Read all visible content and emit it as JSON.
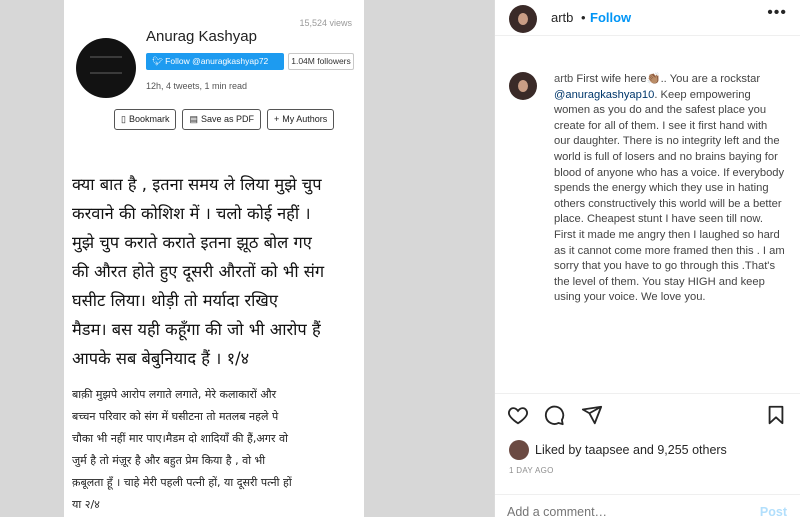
{
  "photo": {
    "views": "15,524 views",
    "author": "Anurag Kashyap",
    "follow_twitter": "Follow @anuragkashyap72",
    "followers": "1.04M followers",
    "meta": "12h, 4 tweets, 1 min read",
    "buttons": {
      "bookmark": "Bookmark",
      "save_pdf": "Save as PDF",
      "my_authors": "My Authors"
    },
    "hindi_big_lines": [
      "क्या बात है , इतना समय ले लिया मुझे चुप",
      "करवाने की कोशिश में । चलो कोई नहीं ।",
      "मुझे चुप कराते कराते इतना झूठ बोल गए",
      "की औरत होते हुए दूसरी औरतों को भी संग",
      "घसीट लिया। थोड़ी तो मर्यादा रखिए",
      "मैडम। बस यही कहूँगा की जो भी आरोप हैं",
      "आपके सब बेबुनियाद हैं । १/४"
    ],
    "hindi_small_lines": [
      "बाक़ी मुझपे आरोप लगाते लगाते, मेरे कलाकारों और",
      "बच्चन परिवार को संग में घसीटना तो मतलब नहले पे",
      "चौका भी नहीं मार पाए।मैडम दो शादियाँ की हैं,अगर वो",
      "जुर्म है तो मंज़ूर है और बहुत प्रेम किया है , वो भी",
      "क़बूलता हूँ । चाहे मेरी पहली पत्नी हों, या दूसरी पत्नी हों",
      "या २/४"
    ]
  },
  "instagram": {
    "header": {
      "username": "artb",
      "separator": "•",
      "follow_label": "Follow",
      "more_icon": "more-horizontal-icon"
    },
    "caption": {
      "username": "artb",
      "text_before_mention": " First wife here👏🏽.. You are a rockstar ",
      "mention": "@anuragkashyap10",
      "text_after_mention": ". Keep empowering women as you do and the safest place you create for all of them. I see it first hand with our daughter. There is no integrity left and the world is full of losers and no brains baying for blood of anyone who has a voice. If everybody spends the energy which they use in hating others constructively this world will be a better place. Cheapest stunt I have seen till now. First it made me angry then I laughed so hard as it cannot come more framed then this . I am sorry that you have to go through this .That's the level of them. You stay HIGH and keep using your voice. We love you."
    },
    "actions": {
      "like_icon": "heart-icon",
      "comment_icon": "comment-icon",
      "share_icon": "share-icon",
      "save_icon": "bookmark-icon"
    },
    "likes_text": "Liked by taapsee and 9,255 others",
    "date": "1 DAY AGO",
    "add_comment_placeholder": "Add a comment…",
    "post_label": "Post"
  }
}
